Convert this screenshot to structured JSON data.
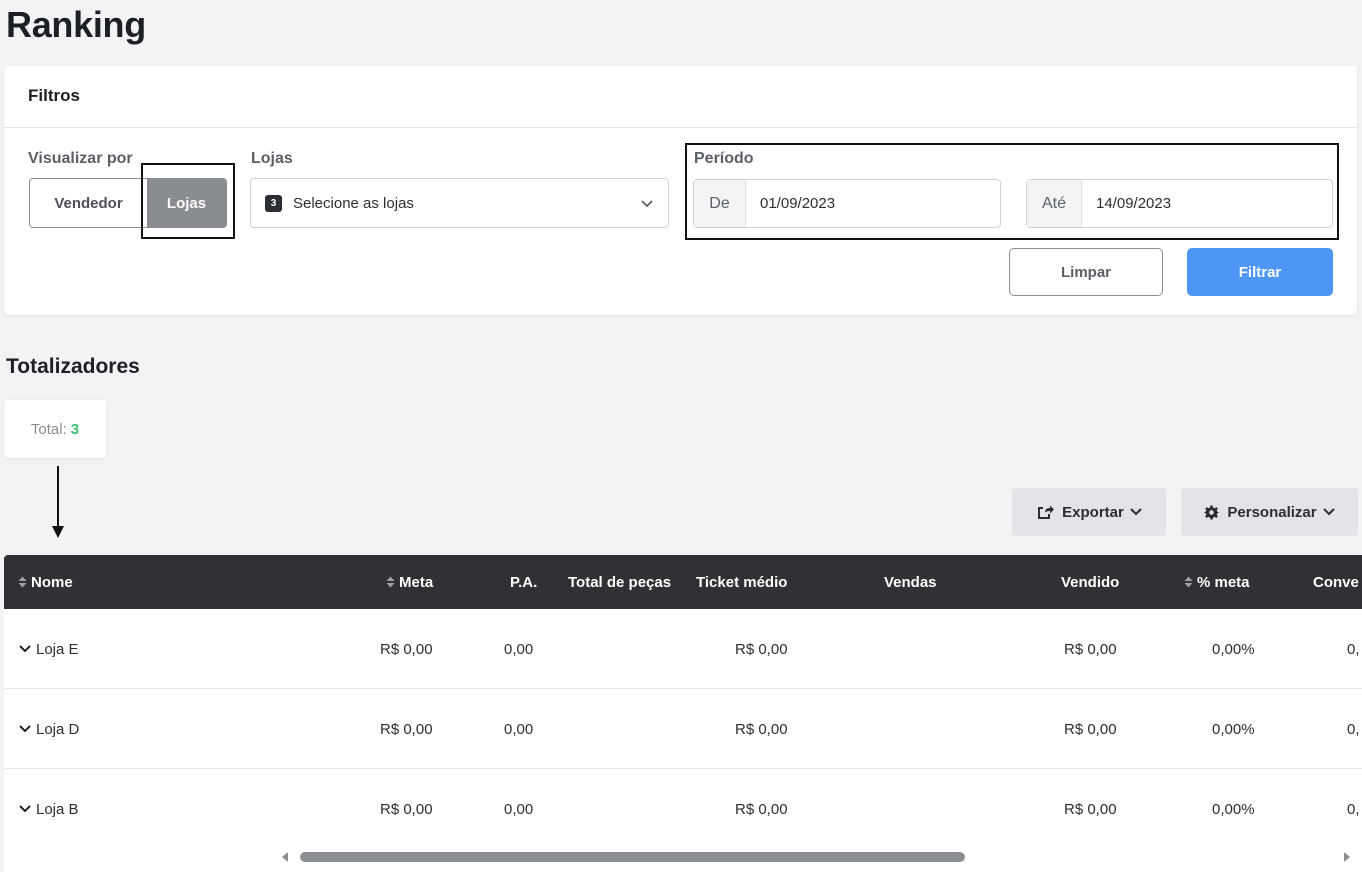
{
  "page": {
    "title": "Ranking"
  },
  "filters": {
    "title": "Filtros",
    "view_by": {
      "label": "Visualizar por",
      "options": [
        "Vendedor",
        "Lojas"
      ],
      "selected": "Lojas"
    },
    "stores": {
      "label": "Lojas",
      "count": "3",
      "placeholder": "Selecione as lojas"
    },
    "period": {
      "label": "Período",
      "from_label": "De",
      "from_value": "01/09/2023",
      "to_label": "Até",
      "to_value": "14/09/2023"
    },
    "clear_label": "Limpar",
    "filter_label": "Filtrar"
  },
  "totals": {
    "title": "Totalizadores",
    "label": "Total:",
    "value": "3"
  },
  "toolbar": {
    "export_label": "Exportar",
    "customize_label": "Personalizar"
  },
  "table": {
    "columns": [
      "Nome",
      "Meta",
      "P.A.",
      "Total de peças",
      "Ticket médio",
      "Vendas",
      "Vendido",
      "% meta",
      "Conve"
    ],
    "rows": [
      {
        "nome": "Loja E",
        "meta": "R$ 0,00",
        "pa": "0,00",
        "total_pecas": "",
        "ticket": "R$ 0,00",
        "vendas": "",
        "vendido": "R$ 0,00",
        "pct_meta": "0,00%",
        "conv": "0,"
      },
      {
        "nome": "Loja D",
        "meta": "R$ 0,00",
        "pa": "0,00",
        "total_pecas": "",
        "ticket": "R$ 0,00",
        "vendas": "",
        "vendido": "R$ 0,00",
        "pct_meta": "0,00%",
        "conv": "0,"
      },
      {
        "nome": "Loja B",
        "meta": "R$ 0,00",
        "pa": "0,00",
        "total_pecas": "",
        "ticket": "R$ 0,00",
        "vendas": "",
        "vendido": "R$ 0,00",
        "pct_meta": "0,00%",
        "conv": "0,"
      }
    ]
  },
  "icons": {
    "sort": "sort-icon",
    "chevron": "chevron-down-icon",
    "export": "share-icon",
    "customize": "gear-icon",
    "scroll_left": "arrow-left-icon",
    "scroll_right": "arrow-right-icon"
  },
  "colors": {
    "primary": "#4d96f5",
    "table_header": "#2f3134",
    "total_value": "#3fbf6e",
    "selected_toggle": "#898c91"
  }
}
